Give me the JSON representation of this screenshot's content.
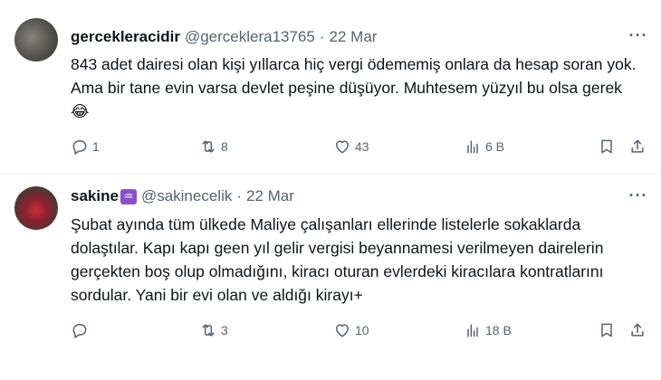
{
  "tweets": [
    {
      "name": "gercekleracidir",
      "handle": "@gerceklera13765",
      "separator": "·",
      "date": "22 Mar",
      "text": "843 adet dairesi olan kişi yıllarca hiç vergi ödememiş onlara da hesap soran yok. Ama bir tane evin varsa devlet peşine düşüyor. Muhtesem yüzyıl bu olsa gerek 😂",
      "replies": "1",
      "reposts": "8",
      "likes": "43",
      "views": "6 B"
    },
    {
      "name": "sakine",
      "badge": "♒",
      "handle": "@sakinecelik",
      "separator": "·",
      "date": "22 Mar",
      "text": "Şubat ayında tüm ülkede Maliye çalışanları ellerinde listelerle sokaklarda dolaştılar. Kapı kapı geen yıl gelir vergisi beyannamesi verilmeyen dairelerin gerçekten boş olup olmadığını, kiracı oturan evlerdeki kiracılara kontratlarını sordular. Yani bir evi olan ve aldığı kirayı+",
      "replies": "",
      "reposts": "3",
      "likes": "10",
      "views": "18 B"
    }
  ],
  "more_label": "···"
}
